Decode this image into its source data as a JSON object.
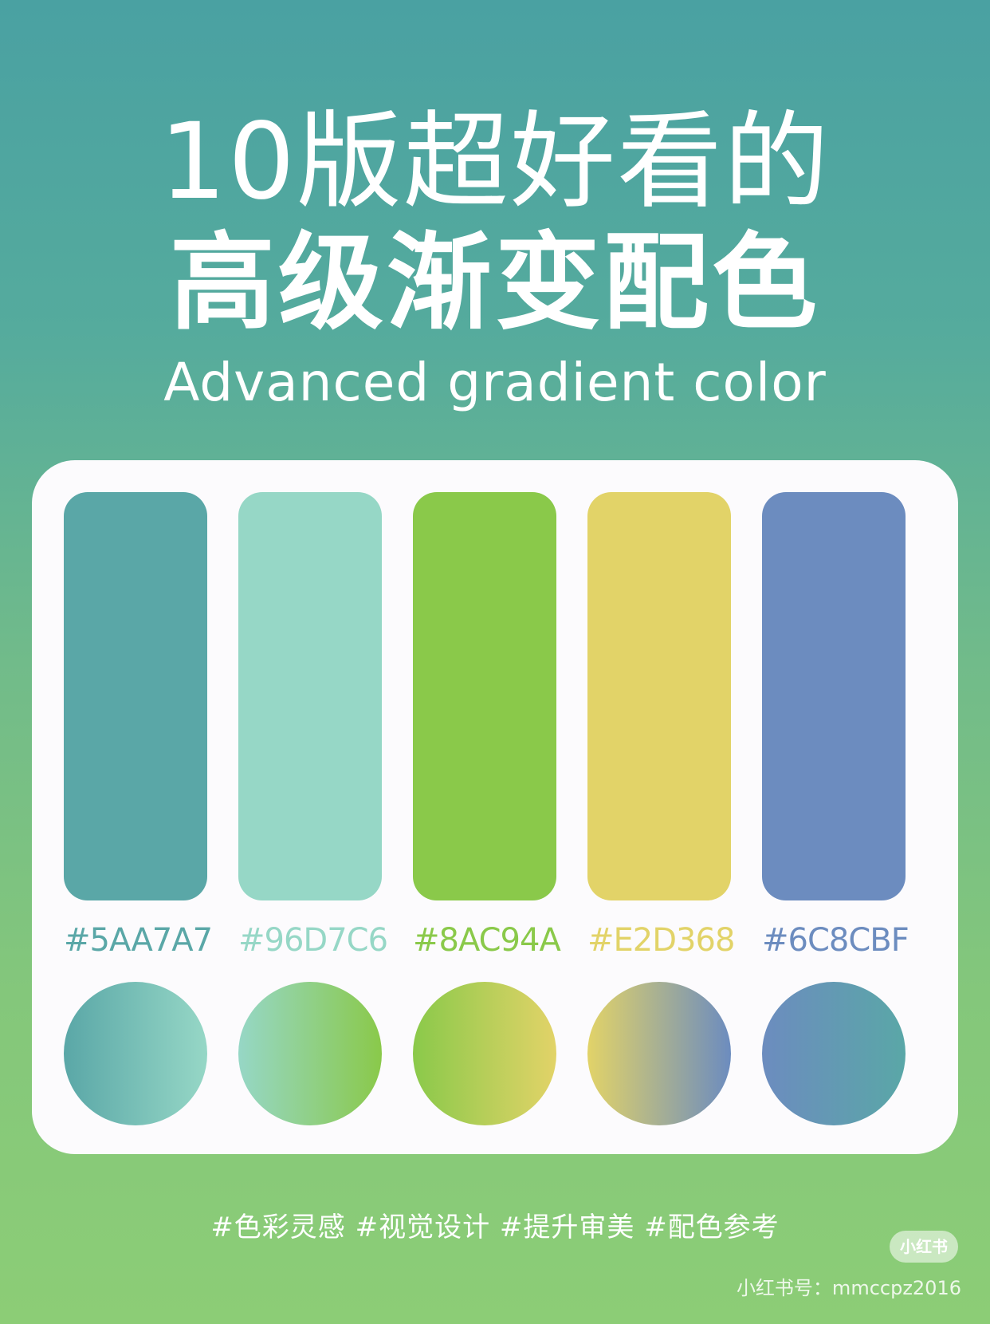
{
  "title": {
    "line1": "10版超好看的",
    "line2": "高级渐变配色",
    "subtitle": "Advanced gradient color"
  },
  "palette": [
    {
      "hex": "#5AA7A7",
      "color": "#5aa7a7"
    },
    {
      "hex": "#96D7C6",
      "color": "#96d7c6"
    },
    {
      "hex": "#8AC94A",
      "color": "#8ac94a"
    },
    {
      "hex": "#E2D368",
      "color": "#e2d368"
    },
    {
      "hex": "#6C8CBF",
      "color": "#6c8cbf"
    }
  ],
  "gradients": [
    {
      "from": "#5aa7a7",
      "to": "#96d7c6"
    },
    {
      "from": "#96d7c6",
      "to": "#8ac94a"
    },
    {
      "from": "#8ac94a",
      "to": "#e2d368"
    },
    {
      "from": "#e2d368",
      "to": "#6c8cbf"
    },
    {
      "from": "#6c8cbf",
      "to": "#5aa7a7"
    }
  ],
  "footer": {
    "tags": "#色彩灵感 #视觉设计 #提升审美 #配色参考",
    "logo": "小红书",
    "account": "小红书号：mmccpz2016"
  }
}
